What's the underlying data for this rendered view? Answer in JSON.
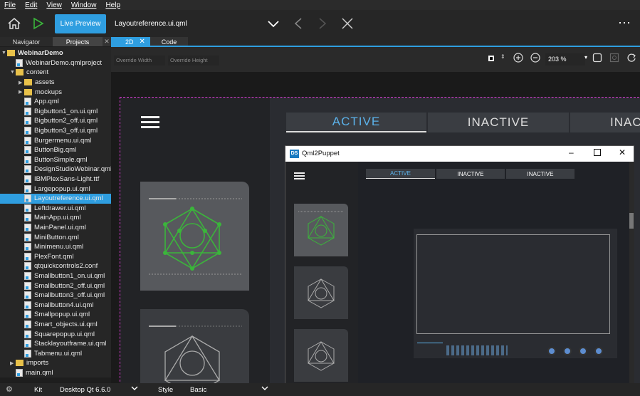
{
  "menu": [
    "File",
    "Edit",
    "View",
    "Window",
    "Help"
  ],
  "toolbar": {
    "live_preview": "Live Preview",
    "file": "Layoutreference.ui.qml",
    "more": "⋯"
  },
  "left_tabs": {
    "navigator": "Navigator",
    "projects": "Projects"
  },
  "tree": [
    {
      "label": "WebinarDemo",
      "kind": "folder",
      "indent": 0,
      "expanded": true,
      "bold": true
    },
    {
      "label": "WebinarDemo.qmlproject",
      "kind": "qml",
      "indent": 1
    },
    {
      "label": "content",
      "kind": "folder",
      "indent": 1,
      "expanded": true
    },
    {
      "label": "assets",
      "kind": "folder",
      "indent": 2,
      "collapsed": true
    },
    {
      "label": "mockups",
      "kind": "folder",
      "indent": 2,
      "collapsed": true
    },
    {
      "label": "App.qml",
      "kind": "qml",
      "indent": 2
    },
    {
      "label": "Bigbutton1_on.ui.qml",
      "kind": "qml",
      "indent": 2
    },
    {
      "label": "Bigbutton2_off.ui.qml",
      "kind": "qml",
      "indent": 2
    },
    {
      "label": "Bigbutton3_off.ui.qml",
      "kind": "qml",
      "indent": 2
    },
    {
      "label": "Burgermenu.ui.qml",
      "kind": "qml",
      "indent": 2
    },
    {
      "label": "ButtonBig.qml",
      "kind": "qml",
      "indent": 2
    },
    {
      "label": "ButtonSimple.qml",
      "kind": "qml",
      "indent": 2
    },
    {
      "label": "DesignStudioWebinar.qml",
      "kind": "qml",
      "indent": 2
    },
    {
      "label": "IBMPlexSans-Light.ttf",
      "kind": "qml",
      "indent": 2
    },
    {
      "label": "Largepopup.ui.qml",
      "kind": "qml",
      "indent": 2
    },
    {
      "label": "Layoutreference.ui.qml",
      "kind": "qml",
      "indent": 2,
      "selected": true
    },
    {
      "label": "Leftdrawer.ui.qml",
      "kind": "qml",
      "indent": 2
    },
    {
      "label": "MainApp.ui.qml",
      "kind": "qml",
      "indent": 2
    },
    {
      "label": "MainPanel.ui.qml",
      "kind": "qml",
      "indent": 2
    },
    {
      "label": "MiniButton.qml",
      "kind": "qml",
      "indent": 2
    },
    {
      "label": "Minimenu.ui.qml",
      "kind": "qml",
      "indent": 2
    },
    {
      "label": "PlexFont.qml",
      "kind": "qml",
      "indent": 2
    },
    {
      "label": "qtquickcontrols2.conf",
      "kind": "qml",
      "indent": 2
    },
    {
      "label": "Smallbutton1_on.ui.qml",
      "kind": "qml",
      "indent": 2
    },
    {
      "label": "Smallbutton2_off.ui.qml",
      "kind": "qml",
      "indent": 2
    },
    {
      "label": "Smallbutton3_off.ui.qml",
      "kind": "qml",
      "indent": 2
    },
    {
      "label": "Smallbutton4.ui.qml",
      "kind": "qml",
      "indent": 2
    },
    {
      "label": "Smallpopup.ui.qml",
      "kind": "qml",
      "indent": 2
    },
    {
      "label": "Smart_objects.ui.qml",
      "kind": "qml",
      "indent": 2
    },
    {
      "label": "Squarepopup.ui.qml",
      "kind": "qml",
      "indent": 2
    },
    {
      "label": "Stacklayoutframe.ui.qml",
      "kind": "qml",
      "indent": 2
    },
    {
      "label": "Tabmenu.ui.qml",
      "kind": "qml",
      "indent": 2
    },
    {
      "label": "imports",
      "kind": "folder",
      "indent": 1,
      "collapsed": true
    },
    {
      "label": "main.qml",
      "kind": "qml",
      "indent": 1
    }
  ],
  "editor_tabs": {
    "design": "2D",
    "code": "Code"
  },
  "subtool": {
    "override_width": "Override Width",
    "override_height": "Override Height",
    "zoom": "203 %"
  },
  "canvas_tabs": [
    "ACTIVE",
    "INACTIVE",
    "INAC"
  ],
  "puppet": {
    "title": "Qml2Puppet",
    "logo": "DS",
    "tabs": [
      "ACTIVE",
      "INACTIVE",
      "INACTIVE"
    ]
  },
  "bottom": {
    "kit_label": "Kit",
    "kit_value": "Desktop Qt 6.6.0",
    "style_label": "Style",
    "style_value": "Basic"
  },
  "colors": {
    "accent": "#2f9ee0",
    "selection_dashed": "#d63ad0",
    "icon_green": "#3bb53b"
  }
}
